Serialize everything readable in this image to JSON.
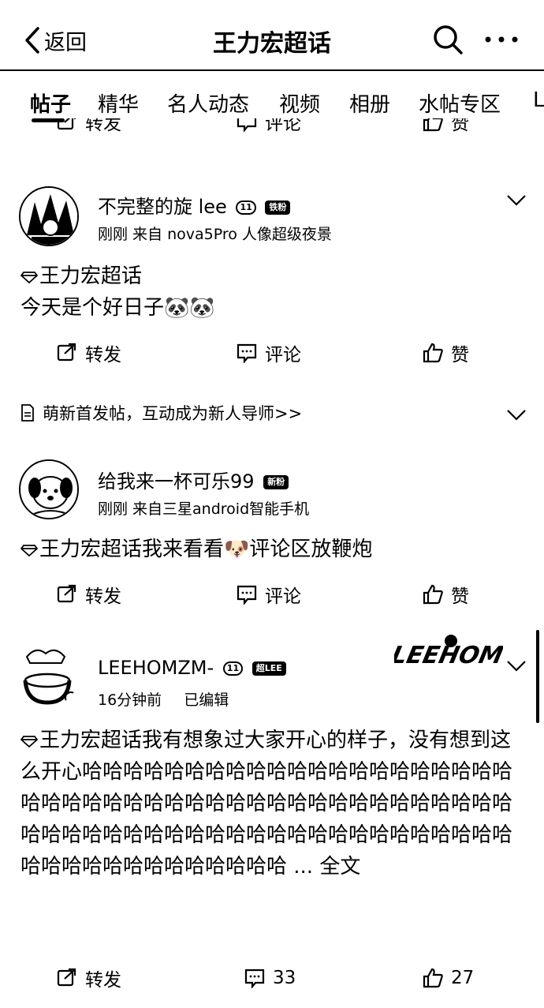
{
  "header": {
    "back_label": "返回",
    "title": "王力宏超话"
  },
  "tabs": [
    {
      "label": "帖子",
      "active": true
    },
    {
      "label": "精华"
    },
    {
      "label": "名人动态"
    },
    {
      "label": "视频"
    },
    {
      "label": "相册"
    },
    {
      "label": "水帖专区"
    },
    {
      "label": "L"
    }
  ],
  "cut_actions": {
    "repost": "转发",
    "comment": "评论",
    "like": "赞"
  },
  "posts": [
    {
      "username": "不完整的旋 lee",
      "badges": [
        "11",
        "铁粉"
      ],
      "meta": "刚刚  来自 nova5Pro 人像超级夜景",
      "topic": "王力宏超话",
      "body": "今天是个好日子",
      "emoji": "🐼🐼",
      "repost": "转发",
      "comment": "评论",
      "like": "赞"
    },
    {
      "username": "给我来一杯可乐99",
      "badges": [
        "新粉"
      ],
      "meta": "刚刚  来自三星android智能手机",
      "topic": "王力宏超话我来看看",
      "emoji": "🐶",
      "body_after": "评论区放鞭炮",
      "repost": "转发",
      "comment": "评论",
      "like": "赞"
    },
    {
      "username": "LEEHOMZM-",
      "badges": [
        "11",
        "超LEE"
      ],
      "meta_time": "16分钟前",
      "meta_edit": "已编辑",
      "logo_text": "LEEHOM",
      "topic": "王力宏超话我有想象过大家开心的样子，没有想到这么开心哈哈哈哈哈哈哈哈哈哈哈哈哈哈哈哈哈哈哈哈哈哈哈哈哈哈哈哈哈哈哈哈哈哈哈哈哈哈哈哈哈哈哈哈哈哈哈哈哈哈哈哈哈哈哈哈哈哈哈哈哈哈哈哈哈哈哈哈哈哈哈哈哈哈哈哈哈哈哈哈哈哈 ... 全文",
      "repost": "转发",
      "comment": "33",
      "like": "27"
    }
  ],
  "notice": "萌新首发帖，互动成为新人导师>>"
}
